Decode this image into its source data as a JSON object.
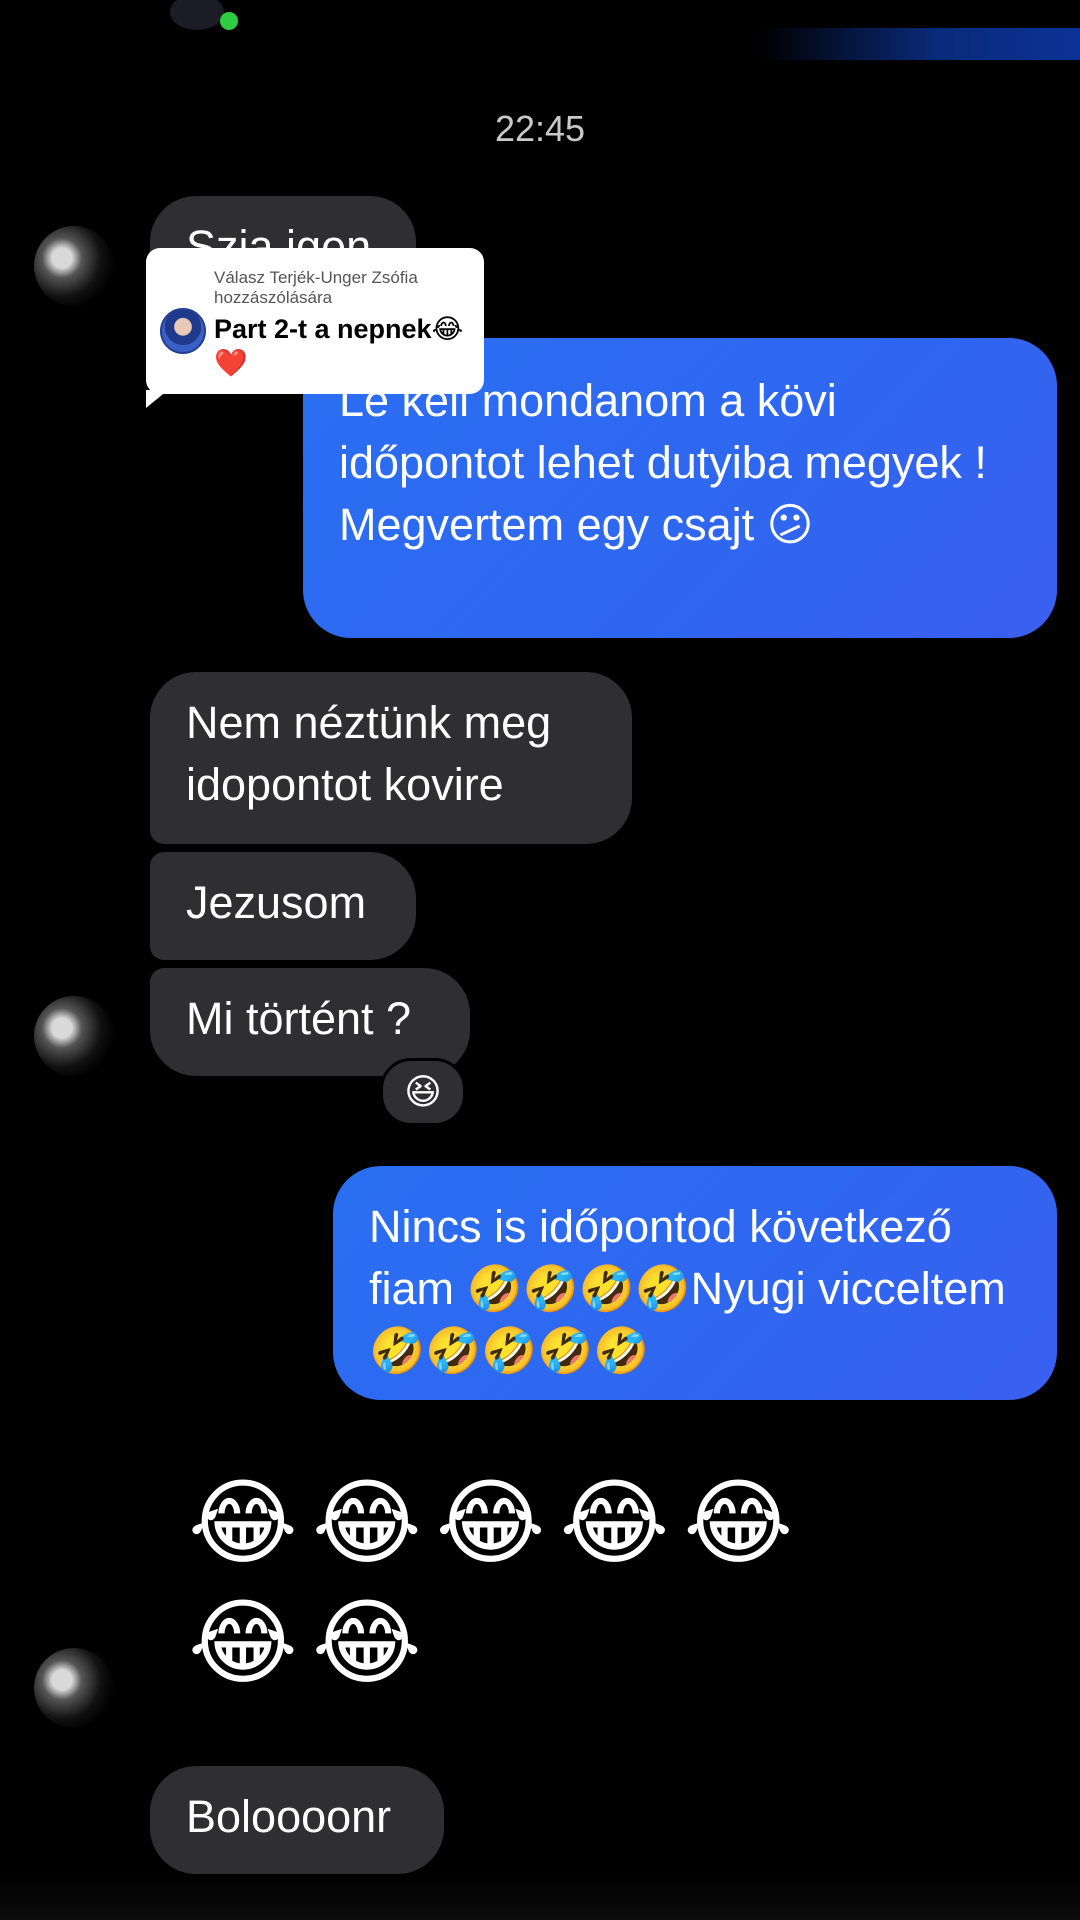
{
  "header": {
    "time": "22:45"
  },
  "reply_card": {
    "caption": "Válasz Terjék-Unger Zsófia hozzászólására",
    "comment": "Part 2-t a nepnek😂❤️"
  },
  "messages": {
    "m1": "Szia igen",
    "m2": "Le kell mondanom a kövi időpontot lehet dutyiba megyek ! Megvertem egy csajt 😕",
    "m3": "Nem néztünk meg idopontot kovire",
    "m4": "Jezusom",
    "m5": "Mi történt ?",
    "m5_reaction": "😆",
    "m6": "Nincs is időpontod következő fiam 🤣🤣🤣🤣Nyugi vicceltem🤣🤣🤣🤣🤣",
    "m7_line1": "😂😂😂😂😂",
    "m7_line2": "😂😂",
    "m8": "Boloooonr"
  },
  "colors": {
    "background": "#000000",
    "incoming_bubble": "#2f2f31",
    "outgoing_bubble": "#2f66f0"
  }
}
